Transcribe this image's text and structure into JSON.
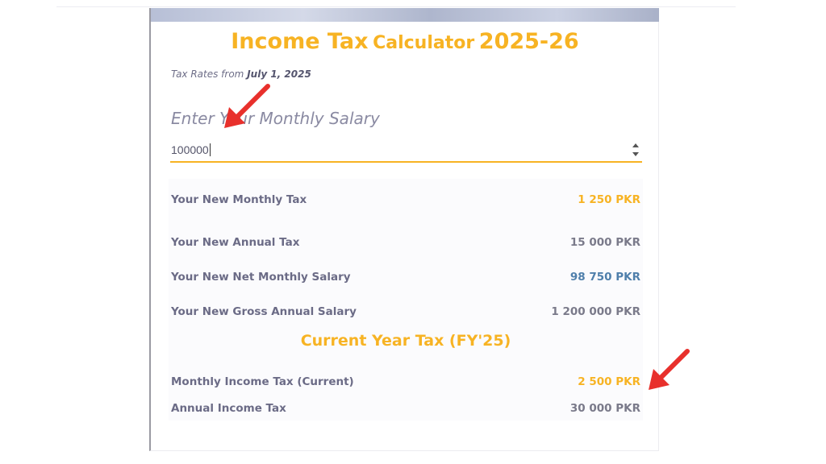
{
  "title": {
    "part1": "Income Tax",
    "part2": "Calculator",
    "part3": "2025-26"
  },
  "subtitle": {
    "prefix": "Tax Rates from",
    "date": "July 1, 2025"
  },
  "salary_input": {
    "label": "Enter Your Monthly Salary",
    "value": "100000"
  },
  "results": [
    {
      "label": "Your New Monthly Tax",
      "value": "1 250 PKR",
      "accent": "orange"
    },
    {
      "label": "Your New Annual Tax",
      "value": "15 000 PKR",
      "accent": "none"
    },
    {
      "label": "Your New Net Monthly Salary",
      "value": "98 750 PKR",
      "accent": "blue"
    },
    {
      "label": "Your New Gross Annual Salary",
      "value": "1 200 000 PKR",
      "accent": "none"
    }
  ],
  "current_year": {
    "heading": "Current Year Tax (FY'25)",
    "rows": [
      {
        "label": "Monthly Income Tax (Current)",
        "value": "2 500 PKR",
        "accent": "orange"
      },
      {
        "label": "Annual Income Tax",
        "value": "30 000 PKR",
        "accent": "none"
      }
    ]
  },
  "colors": {
    "accent_orange": "#f7b323",
    "accent_blue": "#4f7fab",
    "annotation_red": "#e8302c"
  },
  "icons": {
    "spinner_up": "chevron-up-icon",
    "spinner_down": "chevron-down-icon",
    "annotation": "red-arrow-icon"
  }
}
